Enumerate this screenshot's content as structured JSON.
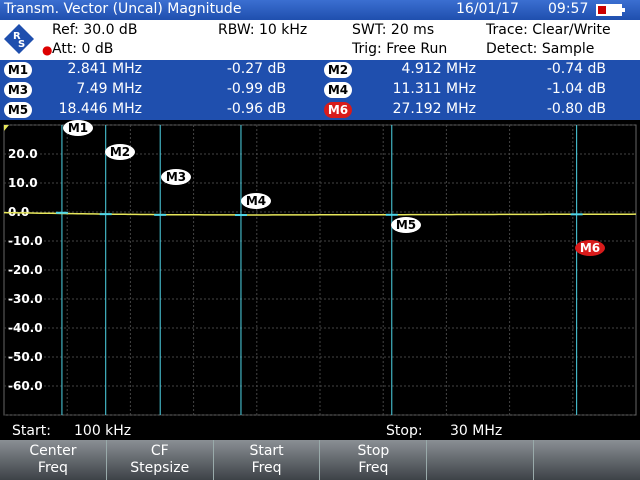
{
  "header": {
    "title": "Transm. Vector (Uncal) Magnitude",
    "date": "16/01/17",
    "time": "09:57"
  },
  "settings": {
    "ref": "Ref: 30.0 dB",
    "att": "Att: 0 dB",
    "rbw": "RBW:  10 kHz",
    "swt": "SWT:  20 ms",
    "trig": "Trig:  Free Run",
    "trace": "Trace:  Clear/Write",
    "detect": "Detect:  Sample"
  },
  "markers": [
    {
      "label": "M1",
      "freq": "2.841 MHz",
      "level": "-0.27 dB",
      "selected": false
    },
    {
      "label": "M2",
      "freq": "4.912 MHz",
      "level": "-0.74 dB",
      "selected": false
    },
    {
      "label": "M3",
      "freq": "7.49 MHz",
      "level": "-0.99 dB",
      "selected": false
    },
    {
      "label": "M4",
      "freq": "11.311 MHz",
      "level": "-1.04 dB",
      "selected": false
    },
    {
      "label": "M5",
      "freq": "18.446 MHz",
      "level": "-0.96 dB",
      "selected": false
    },
    {
      "label": "M6",
      "freq": "27.192 MHz",
      "level": "-0.80 dB",
      "selected": true
    }
  ],
  "chart_data": {
    "type": "line",
    "ylim": [
      -70,
      30
    ],
    "xlim_mhz": [
      0.1,
      30
    ],
    "y_ticks": [
      "20.0",
      "10.0",
      "0.0",
      "-10.0",
      "-20.0",
      "-30.0",
      "-40.0",
      "-50.0",
      "-60.0"
    ],
    "grid": true,
    "trace_color": "#e6e65a",
    "marker_freqs_mhz": [
      2.841,
      4.912,
      7.49,
      11.311,
      18.446,
      27.192
    ],
    "marker_levels_db": [
      -0.27,
      -0.74,
      -0.99,
      -1.04,
      -0.96,
      -0.8
    ]
  },
  "freq": {
    "start_label": "Start:",
    "start": "100 kHz",
    "stop_label": "Stop:",
    "stop": "30 MHz"
  },
  "softkeys": [
    {
      "l1": "Center",
      "l2": "Freq"
    },
    {
      "l1": "CF",
      "l2": "Stepsize"
    },
    {
      "l1": "Start",
      "l2": "Freq"
    },
    {
      "l1": "Stop",
      "l2": "Freq"
    },
    {
      "l1": "",
      "l2": ""
    },
    {
      "l1": "",
      "l2": ""
    }
  ]
}
